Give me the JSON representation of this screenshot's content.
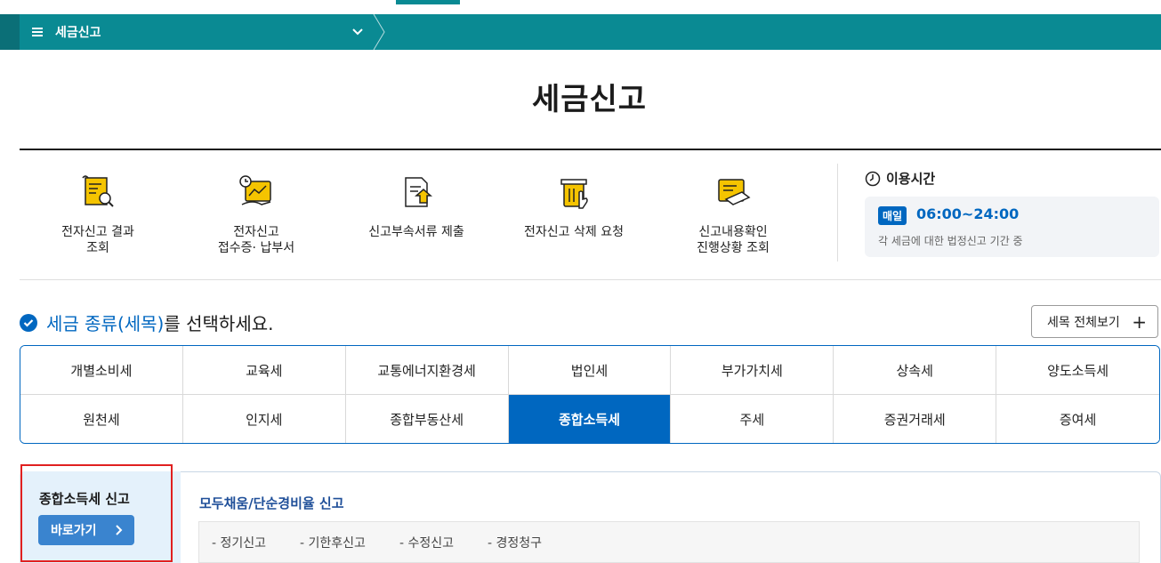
{
  "nav": {
    "menu_label": "세금신고"
  },
  "page": {
    "title": "세금신고"
  },
  "quick_menu": [
    {
      "icon": "scroll-search-icon",
      "line1": "전자신고 결과",
      "line2": "조회"
    },
    {
      "icon": "receipt-payment-icon",
      "line1": "전자신고",
      "line2": "접수증· 납부서"
    },
    {
      "icon": "document-upload-icon",
      "line1": "신고부속서류 제출",
      "line2": ""
    },
    {
      "icon": "trash-delete-icon",
      "line1": "전자신고 삭제 요청",
      "line2": ""
    },
    {
      "icon": "document-check-icon",
      "line1": "신고내용확인",
      "line2": "진행상황 조회"
    }
  ],
  "hours": {
    "title": "이용시간",
    "badge": "매일",
    "time": "06:00~24:00",
    "desc": "각 세금에 대한 법정신고 기간 중"
  },
  "selector": {
    "heading_highlight": "세금 종류(세목)",
    "heading_rest": "를 선택하세요.",
    "view_all_label": "세목 전체보기",
    "view_all_icon": "+"
  },
  "tax_types": [
    [
      "개별소비세",
      "교육세",
      "교통에너지환경세",
      "법인세",
      "부가가치세",
      "상속세",
      "양도소득세"
    ],
    [
      "원천세",
      "인지세",
      "종합부동산세",
      "종합소득세",
      "주세",
      "증권거래세",
      "증여세"
    ]
  ],
  "active_tax": "종합소득세",
  "detail": {
    "side_title": "종합소득세 신고",
    "go_label": "바로가기",
    "go_icon": "›",
    "sub_title": "모두채움/단순경비율 신고",
    "links": [
      "- 정기신고",
      "- 기한후신고",
      "- 수정신고",
      "- 경정청구"
    ]
  },
  "colors": {
    "teal": "#0a8a93",
    "primary_blue": "#0067c0",
    "highlight_red": "#e02020",
    "icon_yellow": "#f5c400"
  }
}
